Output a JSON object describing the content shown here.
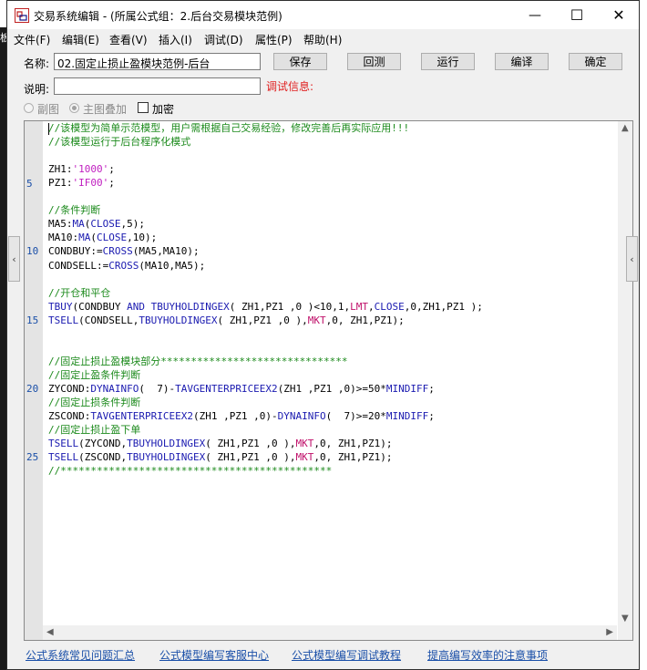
{
  "window": {
    "title": "交易系统编辑 - (所属公式组：2.后台交易模块范例)",
    "controls": {
      "minimize": "—",
      "maximize": "☐",
      "close": "✕"
    }
  },
  "menu": [
    "文件(F)",
    "编辑(E)",
    "查看(V)",
    "插入(I)",
    "调试(D)",
    "属性(P)",
    "帮助(H)"
  ],
  "form": {
    "name_label": "名称:",
    "name_value": "02.固定止损止盈模块范例-后台",
    "desc_label": "说明:",
    "desc_value": "",
    "debug_label": "调试信息:",
    "buttons": {
      "save": "保存",
      "rollback": "回测",
      "run": "运行",
      "compile": "编译",
      "ok": "确定"
    },
    "options": {
      "sub_chart": "副图",
      "main_overlay": "主图叠加",
      "encrypt": "加密"
    }
  },
  "editor": {
    "line_numbers": [
      "5",
      "10",
      "15",
      "20",
      "25"
    ],
    "lines": [
      [
        {
          "t": "//该模型为简单示范模型，用户需根据自己交易经验，修改完善后再实际应用!!!",
          "c": "cm"
        }
      ],
      [
        {
          "t": "//该模型运行于后台程序化模式",
          "c": "cm"
        }
      ],
      [],
      [
        {
          "t": "ZH1:",
          "c": ""
        },
        {
          "t": "'1000'",
          "c": "st"
        },
        {
          "t": ";",
          "c": ""
        }
      ],
      [
        {
          "t": "PZ1:",
          "c": ""
        },
        {
          "t": "'IF00'",
          "c": "st"
        },
        {
          "t": ";",
          "c": ""
        }
      ],
      [],
      [
        {
          "t": "//条件判断",
          "c": "cm"
        }
      ],
      [
        {
          "t": "MA5:",
          "c": ""
        },
        {
          "t": "MA",
          "c": "kw"
        },
        {
          "t": "(",
          "c": ""
        },
        {
          "t": "CLOSE",
          "c": "kw"
        },
        {
          "t": ",5);",
          "c": ""
        }
      ],
      [
        {
          "t": "MA10:",
          "c": ""
        },
        {
          "t": "MA",
          "c": "kw"
        },
        {
          "t": "(",
          "c": ""
        },
        {
          "t": "CLOSE",
          "c": "kw"
        },
        {
          "t": ",10);",
          "c": ""
        }
      ],
      [
        {
          "t": "CONDBUY:=",
          "c": ""
        },
        {
          "t": "CROSS",
          "c": "kw"
        },
        {
          "t": "(MA5,MA10);",
          "c": ""
        }
      ],
      [
        {
          "t": "CONDSELL:=",
          "c": ""
        },
        {
          "t": "CROSS",
          "c": "kw"
        },
        {
          "t": "(MA10,MA5);",
          "c": ""
        }
      ],
      [],
      [
        {
          "t": "//开仓和平仓",
          "c": "cm"
        }
      ],
      [
        {
          "t": "TBUY",
          "c": "kw"
        },
        {
          "t": "(CONDBUY ",
          "c": ""
        },
        {
          "t": "AND",
          "c": "kw"
        },
        {
          "t": " ",
          "c": ""
        },
        {
          "t": "TBUYHOLDINGEX",
          "c": "kw"
        },
        {
          "t": "( ZH1,PZ1 ,0 )<10,1,",
          "c": ""
        },
        {
          "t": "LMT",
          "c": "ef"
        },
        {
          "t": ",",
          "c": ""
        },
        {
          "t": "CLOSE",
          "c": "kw"
        },
        {
          "t": ",0,ZH1,PZ1 );",
          "c": ""
        }
      ],
      [
        {
          "t": "TSELL",
          "c": "kw"
        },
        {
          "t": "(CONDSELL,",
          "c": ""
        },
        {
          "t": "TBUYHOLDINGEX",
          "c": "kw"
        },
        {
          "t": "( ZH1,PZ1 ,0 ),",
          "c": ""
        },
        {
          "t": "MKT",
          "c": "ef"
        },
        {
          "t": ",0, ZH1,PZ1);",
          "c": ""
        }
      ],
      [],
      [],
      [
        {
          "t": "//固定止损止盈模块部分*******************************",
          "c": "cm"
        }
      ],
      [
        {
          "t": "//固定止盈条件判断",
          "c": "cm"
        }
      ],
      [
        {
          "t": "ZYCOND:",
          "c": ""
        },
        {
          "t": "DYNAINFO",
          "c": "kw"
        },
        {
          "t": "(  7)-",
          "c": ""
        },
        {
          "t": "TAVGENTERPRICEEX2",
          "c": "kw"
        },
        {
          "t": "(ZH1 ,PZ1 ,0)>=50*",
          "c": ""
        },
        {
          "t": "MINDIFF",
          "c": "kw"
        },
        {
          "t": ";",
          "c": ""
        }
      ],
      [
        {
          "t": "//固定止损条件判断",
          "c": "cm"
        }
      ],
      [
        {
          "t": "ZSCOND:",
          "c": ""
        },
        {
          "t": "TAVGENTERPRICEEX2",
          "c": "kw"
        },
        {
          "t": "(ZH1 ,PZ1 ,0)-",
          "c": ""
        },
        {
          "t": "DYNAINFO",
          "c": "kw"
        },
        {
          "t": "(  7)>=20*",
          "c": ""
        },
        {
          "t": "MINDIFF",
          "c": "kw"
        },
        {
          "t": ";",
          "c": ""
        }
      ],
      [
        {
          "t": "//固定止损止盈下单",
          "c": "cm"
        }
      ],
      [
        {
          "t": "TSELL",
          "c": "kw"
        },
        {
          "t": "(ZYCOND,",
          "c": ""
        },
        {
          "t": "TBUYHOLDINGEX",
          "c": "kw"
        },
        {
          "t": "( ZH1,PZ1 ,0 ),",
          "c": ""
        },
        {
          "t": "MKT",
          "c": "ef"
        },
        {
          "t": ",0, ZH1,PZ1);",
          "c": ""
        }
      ],
      [
        {
          "t": "TSELL",
          "c": "kw"
        },
        {
          "t": "(ZSCOND,",
          "c": ""
        },
        {
          "t": "TBUYHOLDINGEX",
          "c": "kw"
        },
        {
          "t": "( ZH1,PZ1 ,0 ),",
          "c": ""
        },
        {
          "t": "MKT",
          "c": "ef"
        },
        {
          "t": ",0, ZH1,PZ1);",
          "c": ""
        }
      ],
      [
        {
          "t": "//*********************************************",
          "c": "cm"
        }
      ]
    ]
  },
  "links": [
    "公式系统常见问题汇总",
    "公式模型编写客服中心",
    "公式模型编写调试教程",
    "提高编写效率的注意事项"
  ],
  "background": {
    "left_glyph": "板"
  }
}
